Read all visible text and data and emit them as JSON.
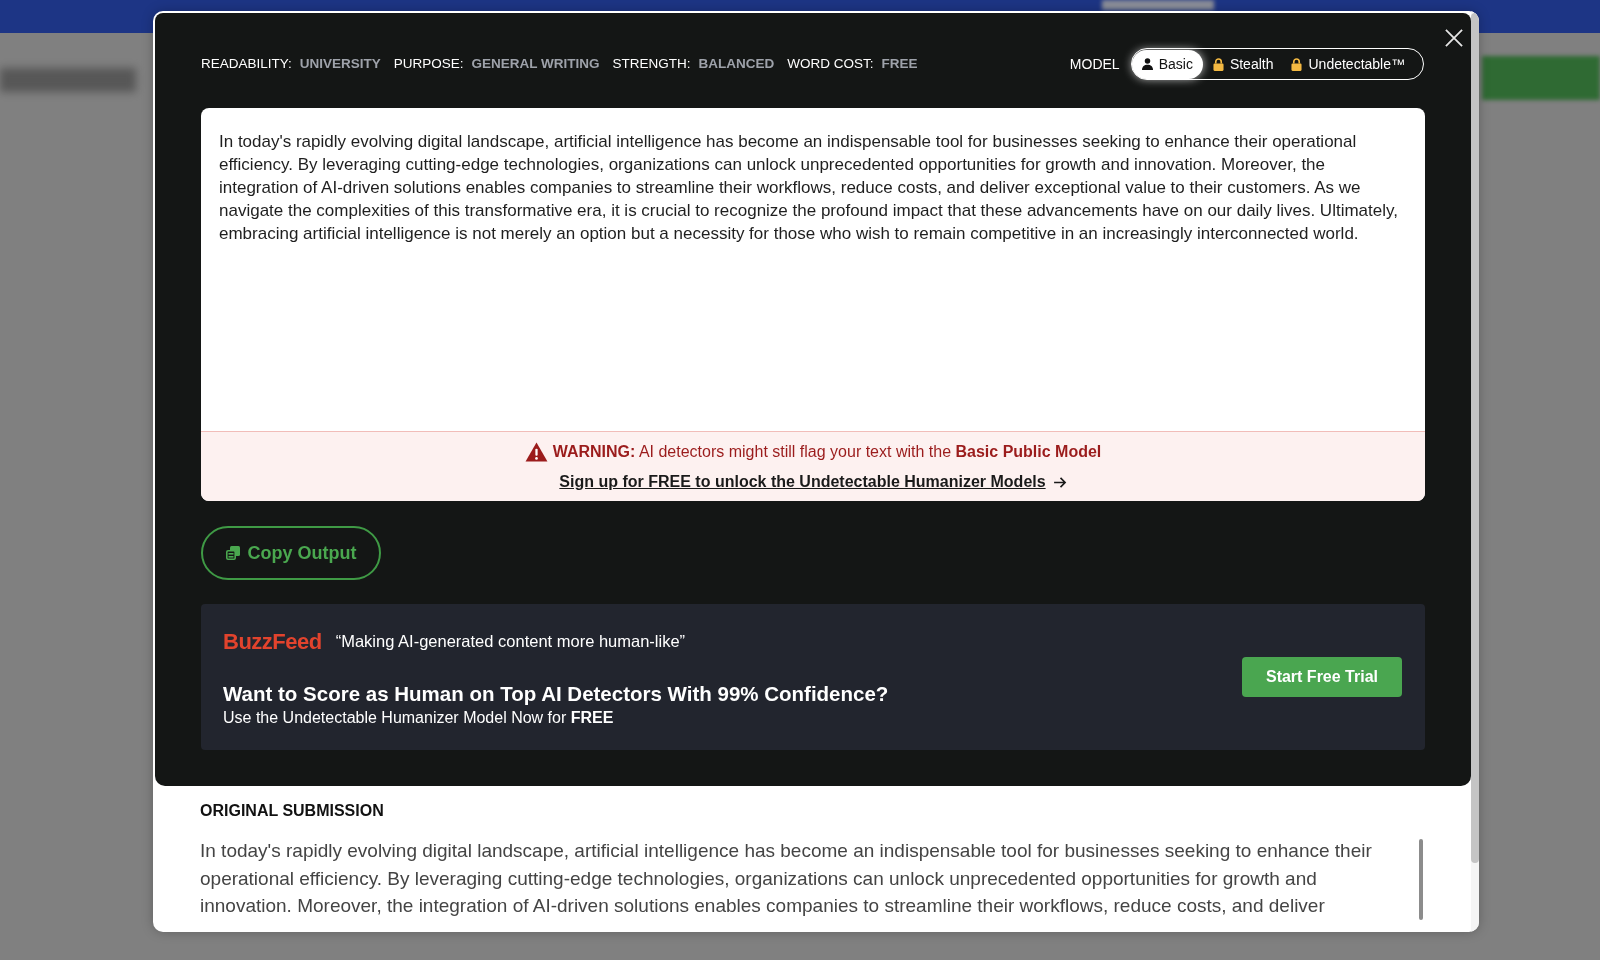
{
  "settings": [
    {
      "label": "READABILITY:",
      "value": "UNIVERSITY"
    },
    {
      "label": "PURPOSE:",
      "value": "GENERAL WRITING"
    },
    {
      "label": "STRENGTH:",
      "value": "BALANCED"
    },
    {
      "label": "WORD COST:",
      "value": "FREE"
    }
  ],
  "model": {
    "label": "MODEL",
    "options": [
      {
        "label": "Basic",
        "selected": true,
        "locked": false
      },
      {
        "label": "Stealth",
        "selected": false,
        "locked": true
      },
      {
        "label": "Undetectable™",
        "selected": false,
        "locked": true
      }
    ]
  },
  "output": {
    "text": "In today's rapidly evolving digital landscape, artificial intelligence has become an indispensable tool for businesses seeking to enhance their operational efficiency. By leveraging cutting-edge technologies, organizations can unlock unprecedented opportunities for growth and innovation. Moreover, the integration of AI-driven solutions enables companies to streamline their workflows, reduce costs, and deliver exceptional value to their customers. As we navigate the complexities of this transformative era, it is crucial to recognize the profound impact that these advancements have on our daily lives. Ultimately, embracing artificial intelligence is not merely an option but a necessity for those who wish to remain competitive in an increasingly interconnected world.",
    "warning": "**WARNING:** AI detectors might still flag your text with the **Basic Public Model**",
    "signup_link": "Sign up for FREE to unlock the Undetectable Humanizer Models"
  },
  "copy_button": "Copy Output",
  "promo": {
    "logo": "BuzzFeed",
    "quote": "“Making AI-generated content more human-like”",
    "heading": "Want to Score as Human on Top AI Detectors With 99% Confidence?",
    "subheading": "Use the Undetectable Humanizer Model Now for **FREE**",
    "button": "Start Free Trial"
  },
  "original_submission": {
    "title": "ORIGINAL SUBMISSION",
    "text": "In today's rapidly evolving digital landscape, artificial intelligence has become an indispensable tool for businesses seeking to enhance their operational efficiency. By leveraging cutting-edge technologies, organizations can unlock unprecedented opportunities for growth and innovation. Moreover, the integration of AI-driven solutions enables companies to streamline their workflows, reduce costs, and deliver"
  }
}
